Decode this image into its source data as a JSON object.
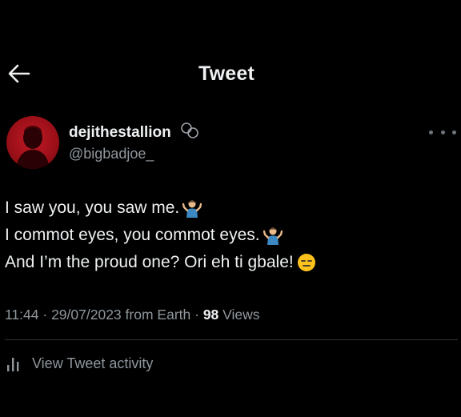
{
  "header": {
    "title": "Tweet"
  },
  "author": {
    "display_name": "dejithestallion",
    "handle": "@bigbadjoe_"
  },
  "tweet": {
    "lines": [
      "I saw you, you saw me.",
      "I commot eyes, you commot eyes.",
      "And I’m the proud one? Ori eh ti gbale!"
    ],
    "emojis": [
      "person-shrugging-icon",
      "person-shrugging-icon",
      "expressionless-face-icon"
    ]
  },
  "meta": {
    "time": "11:44",
    "date": "29/07/2023",
    "source": "from Earth",
    "views_count": "98",
    "views_label": "Views"
  },
  "activity": {
    "label": "View Tweet activity"
  },
  "colors": {
    "background": "#000000",
    "primary_text": "#eef0f1",
    "secondary_text": "#8f969c",
    "divider": "#2f3336",
    "avatar_red": "#c21a25"
  }
}
